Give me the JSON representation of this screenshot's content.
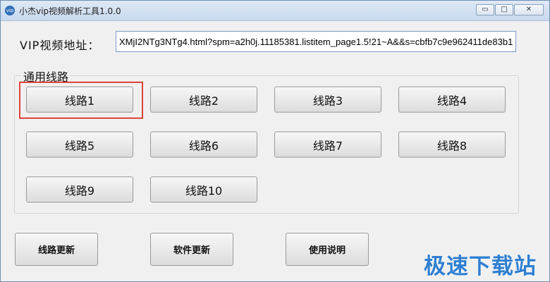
{
  "window": {
    "title": "小杰vip视频解析工具1.0.0",
    "icon_text": "vip",
    "minimize_icon": "▭",
    "maximize_icon": "□",
    "close_icon": "✕"
  },
  "url": {
    "label": "VIP视频地址：",
    "value": "XMjI2NTg3NTg4.html?spm=a2h0j.11185381.listitem_page1.5!21~A&&s=cbfb7c9e962411de83b1"
  },
  "routes": {
    "group_title": "通用线路",
    "buttons": [
      "线路1",
      "线路2",
      "线路3",
      "线路4",
      "线路5",
      "线路6",
      "线路7",
      "线路8",
      "线路9",
      "线路10"
    ]
  },
  "footer": {
    "update_routes": "线路更新",
    "update_software": "软件更新",
    "instructions": "使用说明"
  },
  "watermark": "极速下载站",
  "colors": {
    "highlight": "#e0433a",
    "watermark": "#2f7fd1"
  }
}
